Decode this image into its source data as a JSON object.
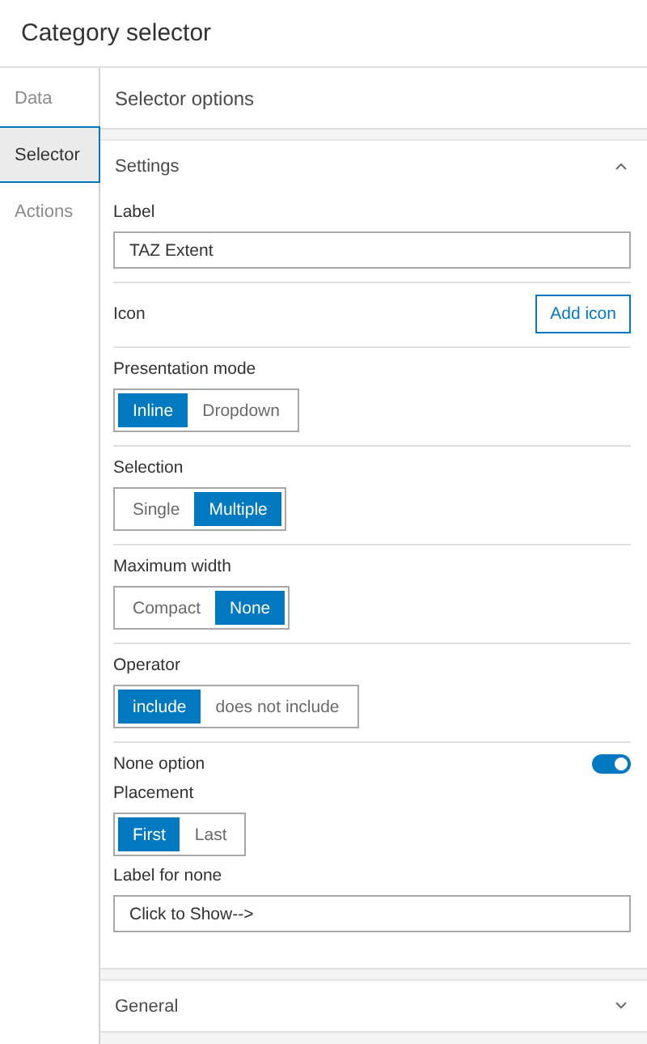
{
  "title": "Category selector",
  "tabs": [
    {
      "label": "Data",
      "selected": false
    },
    {
      "label": "Selector",
      "selected": true
    },
    {
      "label": "Actions",
      "selected": false
    }
  ],
  "panel": {
    "title": "Selector options",
    "sections": [
      {
        "title": "Settings",
        "expanded": true,
        "groups": [
          [
            {
              "kind": "text",
              "label": "Label",
              "value": "TAZ Extent"
            }
          ],
          [
            {
              "kind": "button",
              "label": "Icon",
              "button": "Add icon"
            }
          ],
          [
            {
              "kind": "segmented",
              "label": "Presentation mode",
              "options": [
                {
                  "label": "Inline",
                  "selected": true
                },
                {
                  "label": "Dropdown",
                  "selected": false
                }
              ]
            }
          ],
          [
            {
              "kind": "segmented",
              "label": "Selection",
              "options": [
                {
                  "label": "Single",
                  "selected": false
                },
                {
                  "label": "Multiple",
                  "selected": true
                }
              ]
            }
          ],
          [
            {
              "kind": "segmented",
              "label": "Maximum width",
              "options": [
                {
                  "label": "Compact",
                  "selected": false
                },
                {
                  "label": "None",
                  "selected": true
                }
              ]
            }
          ],
          [
            {
              "kind": "segmented",
              "label": "Operator",
              "options": [
                {
                  "label": "include",
                  "selected": true
                },
                {
                  "label": "does not include",
                  "selected": false
                }
              ]
            }
          ],
          [
            {
              "kind": "toggle",
              "label": "None option",
              "on": true
            },
            {
              "kind": "segmented",
              "label": "Placement",
              "options": [
                {
                  "label": "First",
                  "selected": true
                },
                {
                  "label": "Last",
                  "selected": false
                }
              ]
            },
            {
              "kind": "text",
              "label": "Label for none",
              "value": "Click to Show-->"
            }
          ]
        ]
      },
      {
        "title": "General",
        "expanded": false
      }
    ]
  }
}
